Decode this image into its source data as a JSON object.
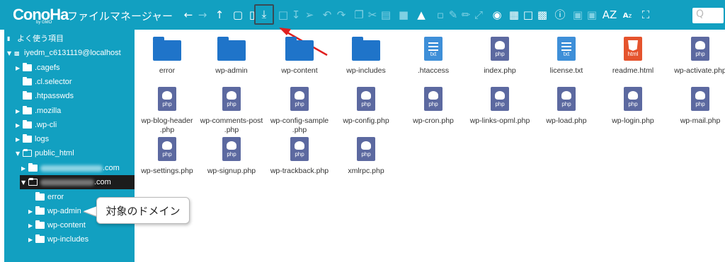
{
  "app": {
    "logo": "ConoHa",
    "logo_sub": "by GMO",
    "title": "ファイルマネージャー"
  },
  "toolbar": {
    "icons": [
      "back-icon",
      "forward-icon",
      "up-icon",
      "new-folder-icon",
      "new-file-icon",
      "upload-icon",
      "folder-icon",
      "download-icon",
      "select-icon",
      "undo-icon",
      "redo-icon",
      "copy-icon",
      "cut-icon",
      "paste-icon",
      "trash-icon",
      "duplicate-icon",
      "rename-icon",
      "edit-icon",
      "resize-icon",
      "preview-icon",
      "select-all-icon",
      "select-none-icon",
      "invert-icon",
      "info-icon",
      "archive-icon",
      "extract-icon",
      "sort-icon",
      "fullscreen-icon"
    ],
    "search_placeholder": "Q"
  },
  "sidebar": {
    "places_label": "よく使う項目",
    "root": "iyedm_c6131119@localhost",
    "items": [
      {
        "label": ".cagefs"
      },
      {
        "label": ".cl.selector"
      },
      {
        "label": ".htpasswds"
      },
      {
        "label": ".mozilla"
      },
      {
        "label": ".wp-cli"
      },
      {
        "label": "logs"
      },
      {
        "label": "public_html"
      }
    ],
    "domain1_suffix": ".com",
    "domain2_suffix": ".com",
    "subitems": [
      {
        "label": "error"
      },
      {
        "label": "wp-admin"
      },
      {
        "label": "wp-content"
      },
      {
        "label": "wp-includes"
      }
    ]
  },
  "callout": {
    "text": "対象のドメイン"
  },
  "files": [
    {
      "name": "error",
      "type": "folder"
    },
    {
      "name": "wp-admin",
      "type": "folder"
    },
    {
      "name": "wp-content",
      "type": "folder"
    },
    {
      "name": "wp-includes",
      "type": "folder"
    },
    {
      "name": ".htaccess",
      "type": "txt"
    },
    {
      "name": "index.php",
      "type": "php"
    },
    {
      "name": "license.txt",
      "type": "txt"
    },
    {
      "name": "readme.html",
      "type": "html"
    },
    {
      "name": "wp-activate.php",
      "type": "php"
    },
    {
      "name": "wp-blog-header\n.php",
      "type": "php"
    },
    {
      "name": "wp-comments-post\n.php",
      "type": "php"
    },
    {
      "name": "wp-config-sample\n.php",
      "type": "php"
    },
    {
      "name": "wp-config.php",
      "type": "php"
    },
    {
      "name": "wp-cron.php",
      "type": "php"
    },
    {
      "name": "wp-links-opml.php",
      "type": "php"
    },
    {
      "name": "wp-load.php",
      "type": "php"
    },
    {
      "name": "wp-login.php",
      "type": "php"
    },
    {
      "name": "wp-mail.php",
      "type": "php"
    },
    {
      "name": "wp-settings.php",
      "type": "php"
    },
    {
      "name": "wp-signup.php",
      "type": "php"
    },
    {
      "name": "wp-trackback.php",
      "type": "php"
    },
    {
      "name": "xmlrpc.php",
      "type": "php"
    }
  ],
  "colors": {
    "toolbar": "#12a0c1",
    "folder": "#1f74c9",
    "php": "#5c69a0",
    "txt": "#3e8fd8",
    "html": "#e5532d",
    "annotation": "#e02020"
  }
}
